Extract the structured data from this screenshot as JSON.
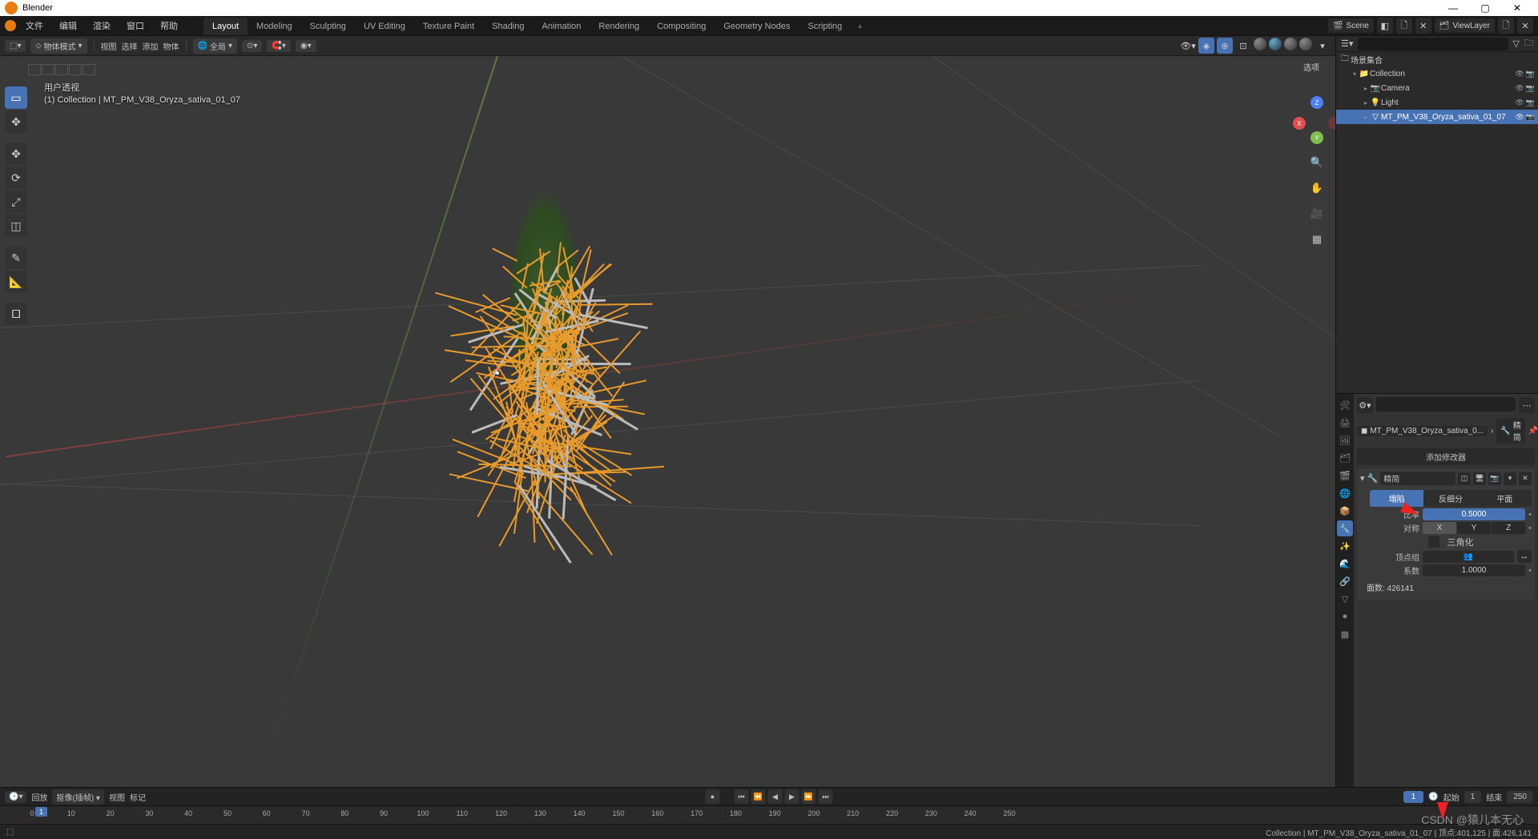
{
  "window": {
    "title": "Blender",
    "min": "—",
    "max": "▢",
    "close": "✕"
  },
  "menus": [
    "文件",
    "编辑",
    "渲染",
    "窗口",
    "帮助"
  ],
  "workspaces": [
    "Layout",
    "Modeling",
    "Sculpting",
    "UV Editing",
    "Texture Paint",
    "Shading",
    "Animation",
    "Rendering",
    "Compositing",
    "Geometry Nodes",
    "Scripting"
  ],
  "active_ws": 0,
  "scene": {
    "label": "Scene",
    "layer": "ViewLayer"
  },
  "viewport_header": {
    "mode": "物体模式",
    "items": [
      "视图",
      "选择",
      "添加",
      "物体"
    ],
    "orient": "全局",
    "options": "选项"
  },
  "overlay": {
    "line1": "用户透视",
    "line2": "(1) Collection | MT_PM_V38_Oryza_sativa_01_07"
  },
  "gizmo": {
    "z": "Z",
    "x": "X",
    "y": "Y"
  },
  "outliner": {
    "title": "场景集合",
    "rows": [
      {
        "indent": 1,
        "icon": "▾",
        "ico2": "📁",
        "label": "Collection",
        "sel": false
      },
      {
        "indent": 2,
        "icon": "▸",
        "ico2": "📷",
        "label": "Camera",
        "sel": false
      },
      {
        "indent": 2,
        "icon": "▸",
        "ico2": "💡",
        "label": "Light",
        "sel": false
      },
      {
        "indent": 2,
        "icon": "▸",
        "ico2": "▽",
        "label": "MT_PM_V38_Oryza_sativa_01_07",
        "sel": true
      }
    ],
    "search_ph": ""
  },
  "props": {
    "search_ph": "",
    "crumb_obj": "MT_PM_V38_Oryza_sativa_0...",
    "crumb_mod": "精简",
    "add_modifier": "添加修改器",
    "mod_name": "精简",
    "modes": [
      "塌陷",
      "反细分",
      "平面"
    ],
    "ratio_label": "比率",
    "ratio_value": "0.5000",
    "sym_label": "对称",
    "axes": [
      "X",
      "Y",
      "Z"
    ],
    "tri_label": "三角化",
    "vgroup_label": "顶点组",
    "factor_label": "系数",
    "factor_value": "1.0000",
    "facecount": "面数: 426141"
  },
  "timeline": {
    "play": "回放",
    "keying": "抠像(插帧)",
    "view": "视图",
    "marker": "标记",
    "start_lbl": "起始",
    "start": "1",
    "end_lbl": "结束",
    "end": "250",
    "cur": "1",
    "ticks": [
      0,
      10,
      20,
      30,
      40,
      50,
      60,
      70,
      80,
      90,
      100,
      110,
      120,
      130,
      140,
      150,
      160,
      170,
      180,
      190,
      200,
      210,
      220,
      230,
      240,
      250
    ]
  },
  "status": {
    "right": "Collection | MT_PM_V38_Oryza_sativa_01_07 | 顶点:401,125 | 面:426,141"
  },
  "watermark": "CSDN @猿儿本无心"
}
